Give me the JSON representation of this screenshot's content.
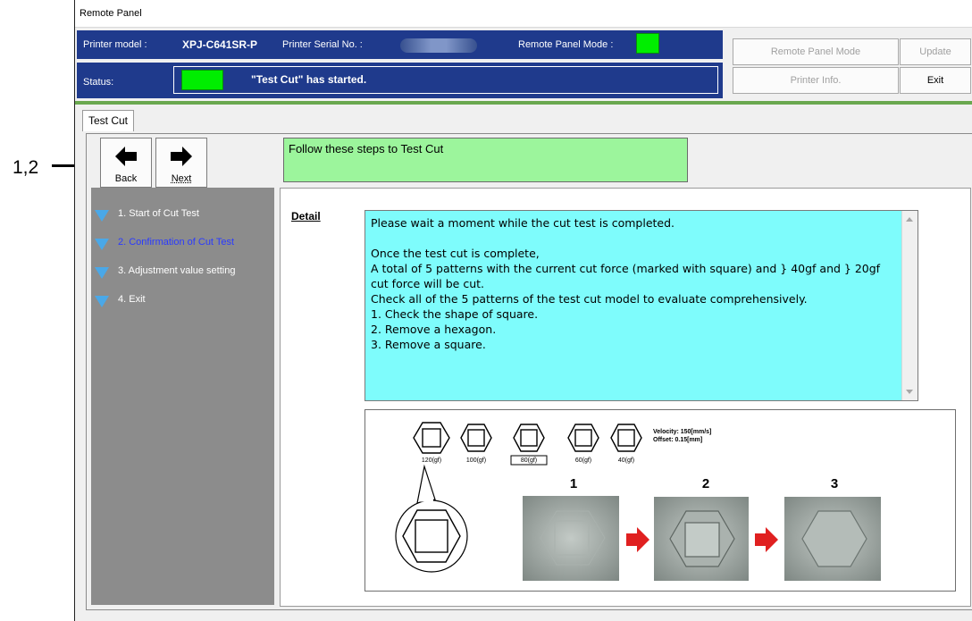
{
  "callout": {
    "label": "1,2"
  },
  "window": {
    "title": "Remote Panel"
  },
  "header": {
    "printer_model_label": "Printer model :",
    "printer_model_value": "XPJ-C641SR-P",
    "serial_label": "Printer Serial No. :",
    "remote_mode_label": "Remote Panel Mode :",
    "status_label": "Status:",
    "status_text": "\"Test Cut\" has started.",
    "led_color": "#00ee00",
    "buttons": {
      "remote_panel_mode": "Remote Panel Mode",
      "update": "Update",
      "printer_info": "Printer Info.",
      "exit": "Exit"
    }
  },
  "tabs": [
    {
      "label": "Test Cut"
    }
  ],
  "nav": {
    "back": "Back",
    "next": "Next"
  },
  "instruction": "Follow these steps to Test Cut",
  "steps": [
    {
      "label": "1. Start of Cut Test",
      "active": false
    },
    {
      "label": "2. Confirmation of Cut Test",
      "active": true
    },
    {
      "label": "3. Adjustment value setting",
      "active": false
    },
    {
      "label": "4. Exit",
      "active": false
    }
  ],
  "detail": {
    "label": "Detail",
    "lines": [
      "Please wait a moment while the cut test is completed.",
      "",
      "Once the test cut is complete,",
      "A total of 5 patterns with the current cut force (marked with square) and } 40gf and } 20gf cut force will be cut.",
      "Check all of the 5 patterns of the test cut model to evaluate comprehensively.",
      "1. Check the shape of square.",
      "2. Remove a hexagon.",
      "3. Remove a square."
    ]
  },
  "figure": {
    "patterns": [
      "120(gf)",
      "100(gf)",
      "80(gf)",
      "60(gf)",
      "40(gf)"
    ],
    "velocity": "Velocity: 150[mm/s]",
    "offset": "Offset:  0.15[mm]",
    "photo_steps": [
      "1",
      "2",
      "3"
    ],
    "arrow_color": "#e02020"
  }
}
